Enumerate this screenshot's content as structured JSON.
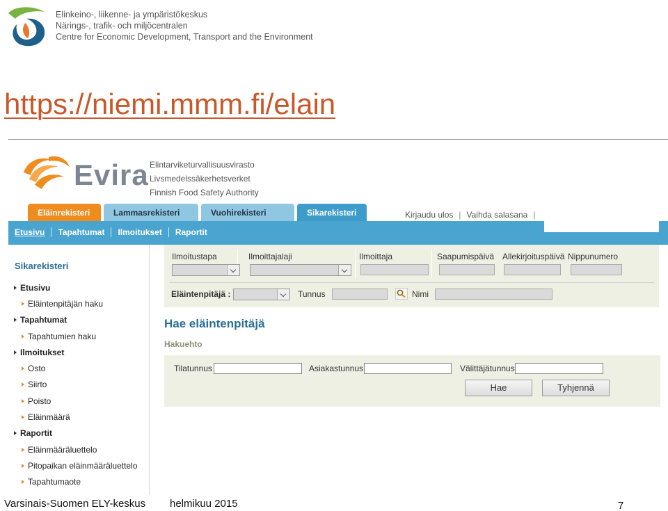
{
  "slide": {
    "ely_names": [
      "Elinkeino-, liikenne- ja ympäristökeskus",
      "Närings-, trafik- och miljöcentralen",
      "Centre for Economic Development, Transport and the Environment"
    ],
    "url": "https://niemi.mmm.fi/elain",
    "footer_left": "Varsinais-Suomen ELY-keskus",
    "footer_date": "helmikuu 2015",
    "page_number": "7"
  },
  "evira": {
    "wordmark": "Evira",
    "names": [
      "Elintarviketurvallisuusvirasto",
      "Livsmedelssäkerhetsverket",
      "Finnish Food Safety Authority"
    ]
  },
  "tabs": [
    "Eläinrekisteri",
    "Lammasrekisteri",
    "Vuohirekisteri",
    "Sikarekisteri"
  ],
  "account": {
    "logout": "Kirjaudu ulos",
    "change_password": "Vaihda salasana",
    "separator": "|"
  },
  "nav": [
    "Etusivu",
    "Tapahtumat",
    "Ilmoitukset",
    "Raportit"
  ],
  "sidebar": {
    "title": "Sikarekisteri",
    "items": [
      {
        "label": "Etusivu",
        "level": "main"
      },
      {
        "label": "Eläintenpitäjän haku",
        "level": "sub"
      },
      {
        "label": "Tapahtumat",
        "level": "main"
      },
      {
        "label": "Tapahtumien haku",
        "level": "sub"
      },
      {
        "label": "Ilmoitukset",
        "level": "main"
      },
      {
        "label": "Osto",
        "level": "sub"
      },
      {
        "label": "Siirto",
        "level": "sub"
      },
      {
        "label": "Poisto",
        "level": "sub"
      },
      {
        "label": "Eläinmäärä",
        "level": "sub"
      },
      {
        "label": "Raportit",
        "level": "main"
      },
      {
        "label": "Eläinmääräluettelo",
        "level": "sub"
      },
      {
        "label": "Pitopaikan eläinmääräluettelo",
        "level": "sub"
      },
      {
        "label": "Tapahtumaote",
        "level": "sub"
      }
    ]
  },
  "filter": {
    "ilmoitustapa": "Ilmoitustapa",
    "ilmoittajalaji": "Ilmoittajalaji",
    "ilmoittaja": "Ilmoittaja",
    "saapumispaiva": "Saapumispäivä",
    "allekirjoituspaiva": "Allekirjoituspäivä",
    "nippunumero": "Nippunumero",
    "elaintenpitaja": "Eläintenpitäjä :",
    "tunnus": "Tunnus",
    "nimi": "Nimi"
  },
  "main": {
    "title": "Hae eläintenpitäjä",
    "section": "Hakuehto",
    "tilatunnus": "Tilatunnus",
    "asiakastunnus": "Asiakastunnus",
    "valittajatunnus": "Välittäjätunnus",
    "search_button": "Hae",
    "clear_button": "Tyhjennä"
  },
  "colors": {
    "ely_orange": "#c8582a",
    "evira_orange": "#f08c1e",
    "nav_blue": "#49a4cf",
    "tab_light_blue": "#8fc7e3",
    "panel_bg": "#eef0e4",
    "heading_blue": "#2a6f97"
  }
}
